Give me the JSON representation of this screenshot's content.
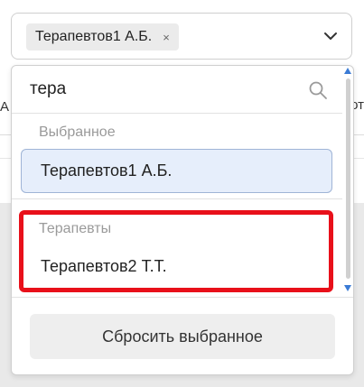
{
  "select": {
    "tag_label": "Терапевтов1 А.Б.",
    "tag_close_glyph": "×",
    "chevron_icon": "chevron-down-icon"
  },
  "dropdown": {
    "search": {
      "value": "тера",
      "icon": "search-icon"
    },
    "selected_group_title": "Выбранное",
    "selected_items": [
      "Терапевтов1 А.Б."
    ],
    "options_group_title": "Терапевты",
    "options": [
      "Терапевтов2 Т.Т."
    ],
    "reset_label": "Сбросить выбранное"
  },
  "background": {
    "left_edge_text": "А",
    "right_edge_text": "от"
  },
  "colors": {
    "highlight": "#e8101a",
    "selected_bg": "#e6eefb",
    "selected_border": "#9fb4d6",
    "scroll_arrows": "#3a7bd5"
  }
}
